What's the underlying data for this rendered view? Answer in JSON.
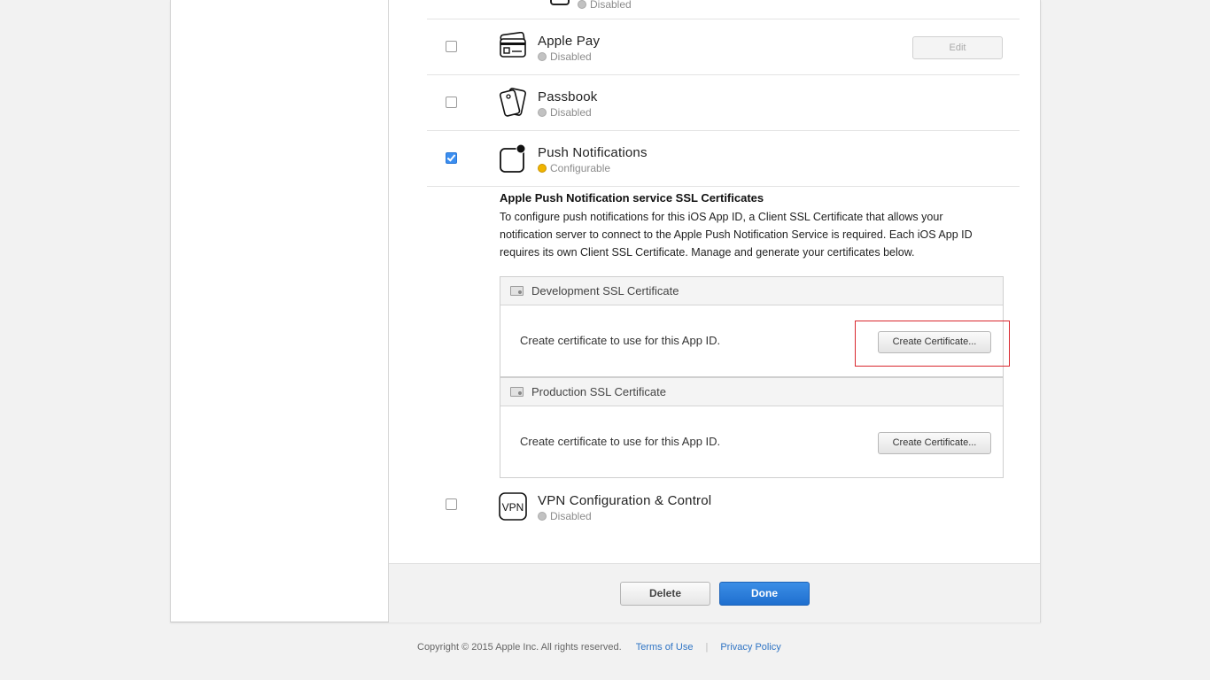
{
  "services": {
    "top_fragment": {
      "status": "Disabled"
    },
    "apple_pay": {
      "name": "Apple Pay",
      "status": "Disabled",
      "edit_label": "Edit",
      "checked": false
    },
    "passbook": {
      "name": "Passbook",
      "status": "Disabled",
      "checked": false
    },
    "push": {
      "name": "Push Notifications",
      "status": "Configurable",
      "checked": true
    },
    "vpn": {
      "name": "VPN Configuration & Control",
      "status": "Disabled",
      "icon_text": "VPN",
      "checked": false
    }
  },
  "apns": {
    "title": "Apple Push Notification service SSL Certificates",
    "description": "To configure push notifications for this iOS App ID, a Client SSL Certificate that allows your notification server to connect to the Apple Push Notification Service is required. Each iOS App ID requires its own Client SSL Certificate. Manage and generate your certificates below.",
    "development": {
      "title": "Development SSL Certificate",
      "description": "Create certificate to use for this App ID.",
      "button": "Create Certificate..."
    },
    "production": {
      "title": "Production SSL Certificate",
      "description": "Create certificate to use for this App ID.",
      "button": "Create Certificate..."
    }
  },
  "actions": {
    "delete_label": "Delete",
    "done_label": "Done"
  },
  "footer": {
    "copyright": "Copyright © 2015 Apple Inc. All rights reserved.",
    "terms": "Terms of Use",
    "separator": "|",
    "privacy": "Privacy Policy"
  },
  "colors": {
    "accent": "#1f6fcf",
    "status_configurable": "#f0b400",
    "status_disabled": "#c2c2c2",
    "highlight": "#d9272e"
  }
}
